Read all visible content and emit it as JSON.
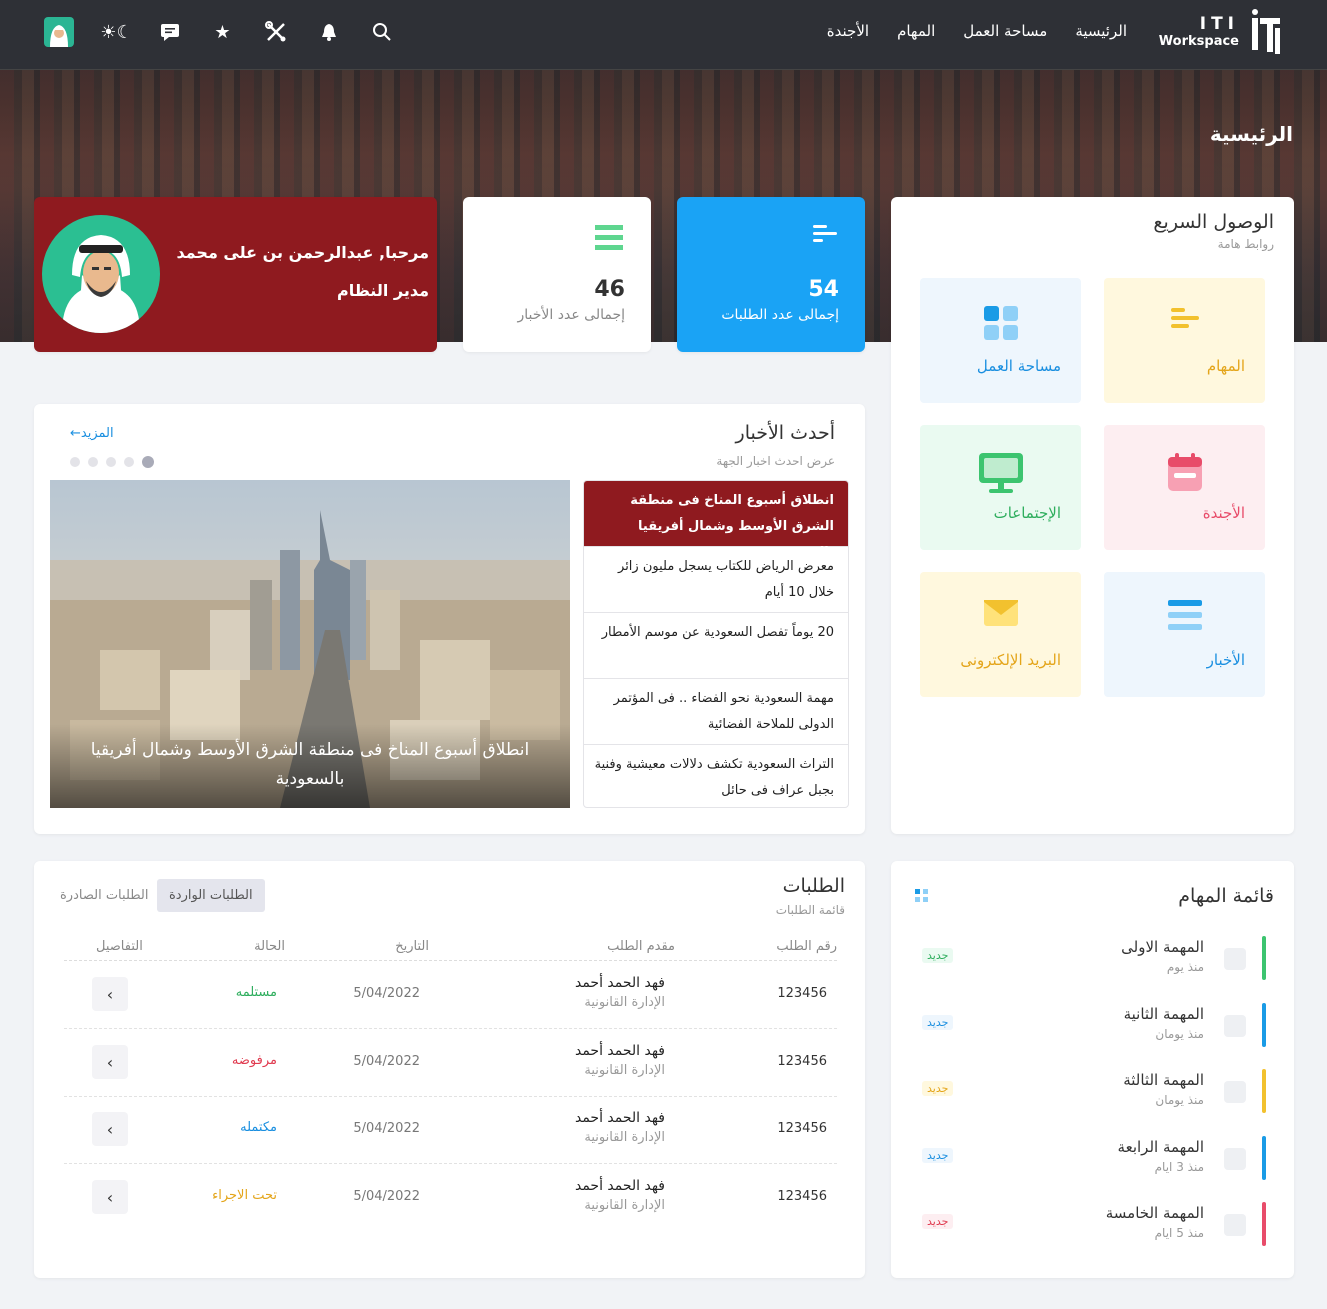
{
  "header": {
    "logo_line1": "ITI",
    "logo_line2": "Workspace",
    "nav": [
      "الرئيسية",
      "مساحة العمل",
      "المهام",
      "الأجندة"
    ],
    "page_title": "الرئيسية"
  },
  "welcome": {
    "name": "مرحبا, عبدالرحمن بن على محمد",
    "role": "مدير النظام"
  },
  "stats": {
    "news_count": "46",
    "news_label": "إجمالى عدد الأخبار",
    "requests_count": "54",
    "requests_label": "إجمالى عدد الطلبات"
  },
  "quick_access": {
    "title": "الوصول السريع",
    "subtitle": "روابط هامة",
    "tiles": [
      "المهام",
      "مساحة العمل",
      "الأجندة",
      "الإجتماعات",
      "الأخبار",
      "البريد الإلكترونى"
    ]
  },
  "news": {
    "title": "أحدث الأخبار",
    "subtitle": "عرض احدث اخبار الجهة",
    "more": "المزيد",
    "caption": "انطلاق أسبوع المناخ فى منطقة الشرق الأوسط وشمال أفريقيا بالسعودية",
    "items": [
      "انطلاق أسبوع المناخ فى منطقة الشرق الأوسط وشمال أفريقيا بالسعودية",
      "معرض الرياض للكتاب يسجل مليون زائر خلال 10 أيام",
      "20 يوماً تفصل السعودية عن موسم الأمطار",
      "مهمة السعودية نحو الفضاء .. فى المؤتمر الدولى للملاحة الفضائية",
      "التراث السعودية تكشف دلالات معيشية وفنية بجبل عراف فى حائل"
    ]
  },
  "requests": {
    "title": "الطلبات",
    "subtitle": "قائمة الطلبات",
    "tab_incoming": "الطلبات الواردة",
    "tab_outgoing": "الطلبات الصادرة",
    "columns": [
      "رقم الطلب",
      "مقدم الطلب",
      "التاريخ",
      "الحالة",
      "التفاصيل"
    ],
    "rows": [
      {
        "num": "123456",
        "name": "فهد الحمد أحمد",
        "dept": "الإدارة القانونية",
        "date": "5/04/2022",
        "status": "مستلمه"
      },
      {
        "num": "123456",
        "name": "فهد الحمد أحمد",
        "dept": "الإدارة القانونية",
        "date": "5/04/2022",
        "status": "مرفوضه"
      },
      {
        "num": "123456",
        "name": "فهد الحمد أحمد",
        "dept": "الإدارة القانونية",
        "date": "5/04/2022",
        "status": "مكتمله"
      },
      {
        "num": "123456",
        "name": "فهد الحمد أحمد",
        "dept": "الإدارة القانونية",
        "date": "5/04/2022",
        "status": "تحت الاجراء"
      }
    ]
  },
  "tasks": {
    "title": "قائمة المهام",
    "items": [
      {
        "name": "المهمة الاولى",
        "ago": "منذ يوم",
        "badge": "جديد",
        "color": "#3cc46f"
      },
      {
        "name": "المهمة الثانية",
        "ago": "منذ يومان",
        "badge": "جديد",
        "color": "#1a9be6"
      },
      {
        "name": "المهمة الثالثة",
        "ago": "منذ يومان",
        "badge": "جديد",
        "color": "#f2c12e"
      },
      {
        "name": "المهمة الرابعة",
        "ago": "منذ 3 ايام",
        "badge": "جديد",
        "color": "#1a9be6"
      },
      {
        "name": "المهمة الخامسة",
        "ago": "منذ 5 ايام",
        "badge": "جديد",
        "color": "#e84c6a"
      }
    ]
  },
  "icons": [
    "avatar-icon",
    "theme-toggle-icon",
    "chat-icon",
    "star-icon",
    "tools-icon",
    "bell-icon",
    "search-icon"
  ]
}
